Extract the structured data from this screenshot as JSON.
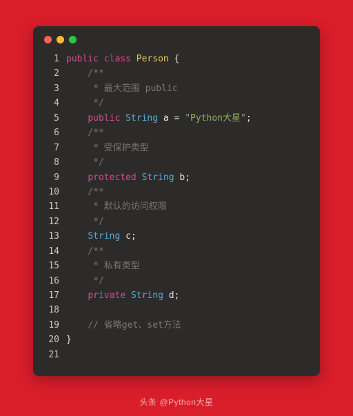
{
  "window": {
    "dots": [
      "red",
      "yellow",
      "green"
    ]
  },
  "code": {
    "lines": [
      {
        "n": "1",
        "tokens": [
          {
            "c": "kw",
            "t": "public"
          },
          {
            "c": "punc",
            "t": " "
          },
          {
            "c": "kw",
            "t": "class"
          },
          {
            "c": "punc",
            "t": " "
          },
          {
            "c": "cls",
            "t": "Person"
          },
          {
            "c": "punc",
            "t": " {"
          }
        ]
      },
      {
        "n": "2",
        "tokens": [
          {
            "c": "cmt",
            "t": "    /**"
          }
        ]
      },
      {
        "n": "3",
        "tokens": [
          {
            "c": "cmt",
            "t": "     * 最大范围 public"
          }
        ]
      },
      {
        "n": "4",
        "tokens": [
          {
            "c": "cmt",
            "t": "     */"
          }
        ]
      },
      {
        "n": "5",
        "tokens": [
          {
            "c": "punc",
            "t": "    "
          },
          {
            "c": "kw",
            "t": "public"
          },
          {
            "c": "punc",
            "t": " "
          },
          {
            "c": "typ",
            "t": "String"
          },
          {
            "c": "punc",
            "t": " "
          },
          {
            "c": "var",
            "t": "a"
          },
          {
            "c": "punc",
            "t": " = "
          },
          {
            "c": "str",
            "t": "\"Python大星\""
          },
          {
            "c": "punc",
            "t": ";"
          }
        ]
      },
      {
        "n": "6",
        "tokens": [
          {
            "c": "cmt",
            "t": "    /**"
          }
        ]
      },
      {
        "n": "7",
        "tokens": [
          {
            "c": "cmt",
            "t": "     * 受保护类型"
          }
        ]
      },
      {
        "n": "8",
        "tokens": [
          {
            "c": "cmt",
            "t": "     */"
          }
        ]
      },
      {
        "n": "9",
        "tokens": [
          {
            "c": "punc",
            "t": "    "
          },
          {
            "c": "kw",
            "t": "protected"
          },
          {
            "c": "punc",
            "t": " "
          },
          {
            "c": "typ",
            "t": "String"
          },
          {
            "c": "punc",
            "t": " "
          },
          {
            "c": "var",
            "t": "b"
          },
          {
            "c": "punc",
            "t": ";"
          }
        ]
      },
      {
        "n": "10",
        "tokens": [
          {
            "c": "cmt",
            "t": "    /**"
          }
        ]
      },
      {
        "n": "11",
        "tokens": [
          {
            "c": "cmt",
            "t": "     * 默认的访问权限"
          }
        ]
      },
      {
        "n": "12",
        "tokens": [
          {
            "c": "cmt",
            "t": "     */"
          }
        ]
      },
      {
        "n": "13",
        "tokens": [
          {
            "c": "punc",
            "t": "    "
          },
          {
            "c": "typ",
            "t": "String"
          },
          {
            "c": "punc",
            "t": " "
          },
          {
            "c": "var",
            "t": "c"
          },
          {
            "c": "punc",
            "t": ";"
          }
        ]
      },
      {
        "n": "14",
        "tokens": [
          {
            "c": "cmt",
            "t": "    /**"
          }
        ]
      },
      {
        "n": "15",
        "tokens": [
          {
            "c": "cmt",
            "t": "     * 私有类型"
          }
        ]
      },
      {
        "n": "16",
        "tokens": [
          {
            "c": "cmt",
            "t": "     */"
          }
        ]
      },
      {
        "n": "17",
        "tokens": [
          {
            "c": "punc",
            "t": "    "
          },
          {
            "c": "kw",
            "t": "private"
          },
          {
            "c": "punc",
            "t": " "
          },
          {
            "c": "typ",
            "t": "String"
          },
          {
            "c": "punc",
            "t": " "
          },
          {
            "c": "var",
            "t": "d"
          },
          {
            "c": "punc",
            "t": ";"
          }
        ]
      },
      {
        "n": "18",
        "tokens": [
          {
            "c": "punc",
            "t": ""
          }
        ]
      },
      {
        "n": "19",
        "tokens": [
          {
            "c": "cmt",
            "t": "    // 省略get、set方法"
          }
        ]
      },
      {
        "n": "20",
        "tokens": [
          {
            "c": "punc",
            "t": "}"
          }
        ]
      },
      {
        "n": "21",
        "tokens": [
          {
            "c": "punc",
            "t": ""
          }
        ]
      }
    ]
  },
  "watermark": "头条 @Python大星"
}
